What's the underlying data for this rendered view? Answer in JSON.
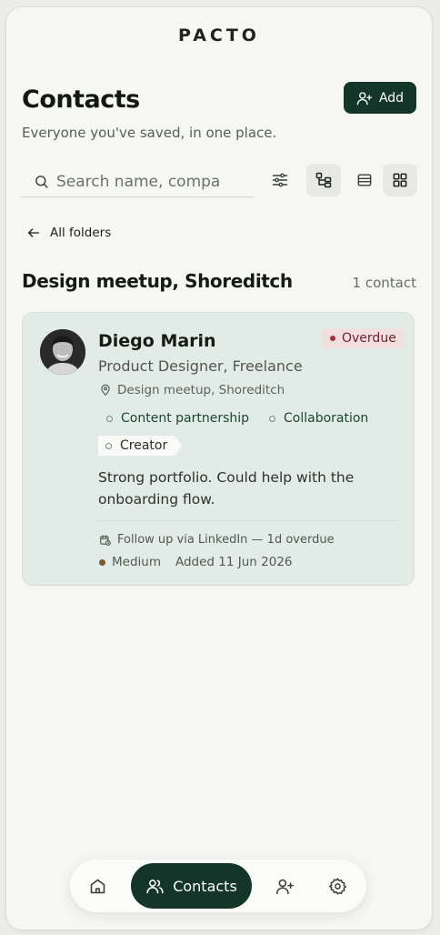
{
  "app": {
    "brand": "PACTO"
  },
  "header": {
    "title": "Contacts",
    "subtitle": "Everyone you've saved, in one place.",
    "add_label": "Add"
  },
  "search": {
    "placeholder": "Search name, compa",
    "value": ""
  },
  "toolbar": {
    "filter_icon": "sliders-icon",
    "tree_icon": "folder-tree-icon",
    "list_icon": "list-view-icon",
    "grid_icon": "grid-view-icon",
    "active_view": "grid"
  },
  "breadcrumb": {
    "back_label": "All folders"
  },
  "folder": {
    "title": "Design meetup, Shoreditch",
    "count_label": "1 contact"
  },
  "contacts": [
    {
      "name": "Diego Marin",
      "role": "Product Designer, Freelance",
      "location": "Design meetup, Shoreditch",
      "status": "Overdue",
      "tags": [
        "Content partnership",
        "Collaboration",
        "Creator"
      ],
      "note": "Strong portfolio. Could help with the onboarding flow.",
      "follow_up": "Follow up via LinkedIn — 1d overdue",
      "priority": "Medium",
      "added": "Added 11 Jun 2026"
    }
  ],
  "bottom_nav": {
    "items": [
      {
        "icon": "home-icon",
        "label": ""
      },
      {
        "icon": "contacts-icon",
        "label": "Contacts",
        "active": true
      },
      {
        "icon": "add-user-icon",
        "label": ""
      },
      {
        "icon": "settings-gear-icon",
        "label": ""
      }
    ]
  },
  "colors": {
    "primary": "#14362a",
    "card_bg": "#e1ece8",
    "overdue_bg": "#f3dede",
    "overdue_dot": "#a23040",
    "priority_medium": "#7a5a2a"
  }
}
